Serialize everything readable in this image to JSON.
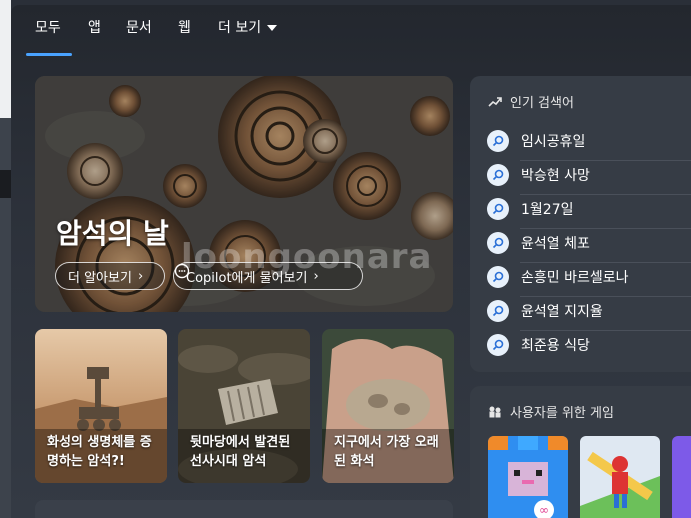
{
  "tabs": [
    {
      "label": "모두"
    },
    {
      "label": "앱"
    },
    {
      "label": "문서"
    },
    {
      "label": "웹"
    },
    {
      "label": "더 보기"
    }
  ],
  "hero": {
    "title": "암석의 날",
    "learn_more": "더 알아보기",
    "ask_copilot": "Copilot에게 물어보기",
    "watermark": "loongoonara"
  },
  "cards": [
    {
      "caption": "화성의 생명체를 증명하는 암석?!"
    },
    {
      "caption": "뒷마당에서 발견된 선사시대 암석"
    },
    {
      "caption": "지구에서 가장 오래된 화석"
    }
  ],
  "trending": {
    "title": "인기 검색어",
    "items": [
      "임시공휴일",
      "박승현 사망",
      "1월27일",
      "윤석열 체포",
      "손흥민 바르셀로나",
      "윤석열 지지율",
      "최준용 식당"
    ]
  },
  "games": {
    "title": "사용자를 위한 게임"
  },
  "colors": {
    "accent": "#4aa3ff",
    "panel": "#363c45",
    "background": "#2a2f38"
  }
}
